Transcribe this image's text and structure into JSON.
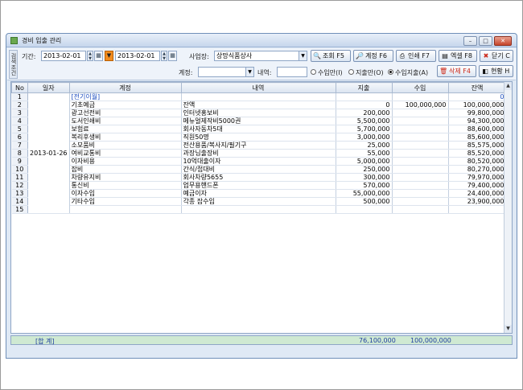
{
  "window": {
    "title": "경비 입출 관리",
    "controls": [
      "minimize",
      "maximize",
      "close"
    ]
  },
  "toolbar": {
    "side_label": "검색조건",
    "period_label": "기간:",
    "date_from": "2013-02-01",
    "date_to": "2013-02-01",
    "business_label": "사업장:",
    "business_value": "상망식품상사",
    "account_label": "계정:",
    "account_value": "",
    "description_label": "내역:",
    "description_value": "",
    "radio_income_only": "수입만(I)",
    "radio_expense_only": "지출만(O)",
    "radio_both": "수입지출(A)",
    "selected_radio": "both",
    "buttons": {
      "search": "조회 F5",
      "account": "계정 F6",
      "print": "인쇄 F7",
      "excel": "엑셀 F8",
      "close": "닫기 C",
      "delete": "삭제 F4",
      "status": "현황 H"
    }
  },
  "grid": {
    "columns": [
      "No",
      "일자",
      "계정",
      "내역",
      "지출",
      "수입",
      "잔액"
    ],
    "date_merged": "2013-01-26",
    "rows": [
      {
        "no": "1",
        "account": "[전기이월]",
        "desc": "",
        "expense": "",
        "income": "",
        "balance": "0",
        "blue": true
      },
      {
        "no": "2",
        "account": "기초예금",
        "desc": "잔액",
        "expense": "0",
        "income": "100,000,000",
        "balance": "100,000,000"
      },
      {
        "no": "3",
        "account": "광고선전비",
        "desc": "인터넷홍보비",
        "expense": "200,000",
        "income": "",
        "balance": "99,800,000"
      },
      {
        "no": "4",
        "account": "도서인쇄비",
        "desc": "메뉴얼제작비5000권",
        "expense": "5,500,000",
        "income": "",
        "balance": "94,300,000"
      },
      {
        "no": "5",
        "account": "보험료",
        "desc": "회사자동차5대",
        "expense": "5,700,000",
        "income": "",
        "balance": "88,600,000"
      },
      {
        "no": "6",
        "account": "복리후생비",
        "desc": "직원50명",
        "expense": "3,000,000",
        "income": "",
        "balance": "85,600,000"
      },
      {
        "no": "7",
        "account": "소모품비",
        "desc": "전산용품/복사지/필기구",
        "expense": "25,000",
        "income": "",
        "balance": "85,575,000"
      },
      {
        "no": "8",
        "account": "여비교통비",
        "desc": "과장님출장비",
        "expense": "55,000",
        "income": "",
        "balance": "85,520,000"
      },
      {
        "no": "9",
        "account": "이자비용",
        "desc": "10억대출이자",
        "expense": "5,000,000",
        "income": "",
        "balance": "80,520,000"
      },
      {
        "no": "10",
        "account": "잡비",
        "desc": "간식/접대비",
        "expense": "250,000",
        "income": "",
        "balance": "80,270,000"
      },
      {
        "no": "11",
        "account": "차량유지비",
        "desc": "회사차량5655",
        "expense": "300,000",
        "income": "",
        "balance": "79,970,000"
      },
      {
        "no": "12",
        "account": "통신비",
        "desc": "업무용핸드폰",
        "expense": "570,000",
        "income": "",
        "balance": "79,400,000"
      },
      {
        "no": "13",
        "account": "이자수입",
        "desc": "예금이자",
        "expense": "55,000,000",
        "income": "",
        "balance": "24,400,000"
      },
      {
        "no": "14",
        "account": "기타수입",
        "desc": "각종 잡수입",
        "expense": "500,000",
        "income": "",
        "balance": "23,900,000"
      },
      {
        "no": "15",
        "account": "",
        "desc": "",
        "expense": "",
        "income": "",
        "balance": ""
      }
    ]
  },
  "footer": {
    "label": "[합 계]",
    "total_expense": "76,100,000",
    "total_income": "100,000,000"
  },
  "colors": {
    "window_border": "#6f8fb8",
    "header_bg": "#dbe4f0",
    "footer_bg": "#cfe9d2",
    "link_blue": "#1f4fbf",
    "delete_red": "#cc2a1a"
  }
}
